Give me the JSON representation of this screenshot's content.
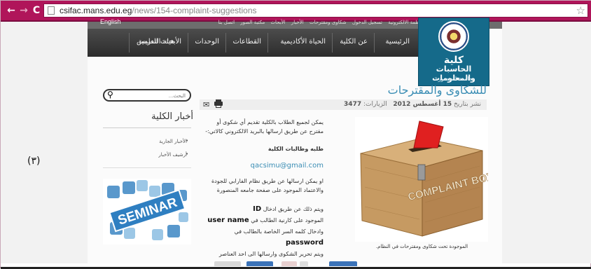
{
  "browser": {
    "url_host": "csifac.mans.edu.eg",
    "url_path": "/news/154-complaint-suggestions",
    "icons": [
      "back-arrow-icon",
      "forward-arrow-icon",
      "reload-icon",
      "page-icon",
      "star-icon"
    ]
  },
  "site": {
    "top_links": [
      "الأنظمة الالكترونية",
      "تسجيل الدخول",
      "شكاوى ومقترحات",
      "الأخبار",
      "الأبحاث",
      "مكتبة الصور",
      "اتصل بنا"
    ],
    "english_link": "English",
    "nav": [
      "الرئيسية",
      "عن الكلية",
      "الحياة الأكاديمية",
      "القطاعات",
      "الوحدات",
      "الأبحاث العلمية",
      "هيئة التدريس"
    ],
    "logo": {
      "line1": "كلية",
      "line2": "الحاسبات والمعلومات",
      "line3": "جامعة المنصورة"
    }
  },
  "article": {
    "title": "للشكاوى والمقترحات",
    "meta_date_label": "نشر بتاريخ",
    "meta_date": "15 أغسطس 2012",
    "meta_visits_label": "الزيارات:",
    "meta_visits": "3477",
    "p1": "يمكن لجميع الطلاب بالكلية تقديم أي شكوى أو مقترح عن طريق ارسالها بالبريد الالكتروني كالاتي:-",
    "p2": "طلبه وطالبات الكلية",
    "p3": "qacsimu@gmail.com",
    "p4": "او يمكن ارسالها عن طريق نظام الفارابي للجودة والاعتماد الموجود على صفحة جامعه المنصورة",
    "p5_line1_pre": "ويتم ذلك عن طريق ادخال",
    "p5_line1_bold": "ID",
    "p5_line2_pre": "الموجود على كارنية الطالب في",
    "p5_line2_bold": "user name",
    "p5_line3_pre": "وادخال كلمه السر الخاصة بالطالب في",
    "p5_line3_bold": "password",
    "p5_line4": "ويتم تحرير الشكوى وارسالها الى احد العناصر",
    "box_label": "COMPLAINT BOX",
    "caption": "الموجودة تحت شكاوى ومقترحات في النظام."
  },
  "sidebar": {
    "search_placeholder": "البحث...",
    "news_title": "أخبار الكلية",
    "news_links": [
      "الأخبار الجارية",
      "أرشيف الأخبار"
    ],
    "banner_text": "SEMINAR"
  },
  "annotation": {
    "label": "(٣)"
  },
  "colors": {
    "browser_bar": "#b0155a",
    "logo_bg": "#156a8a",
    "nav_bg": "#3a3a3a",
    "title_blue": "#3a8db4"
  }
}
